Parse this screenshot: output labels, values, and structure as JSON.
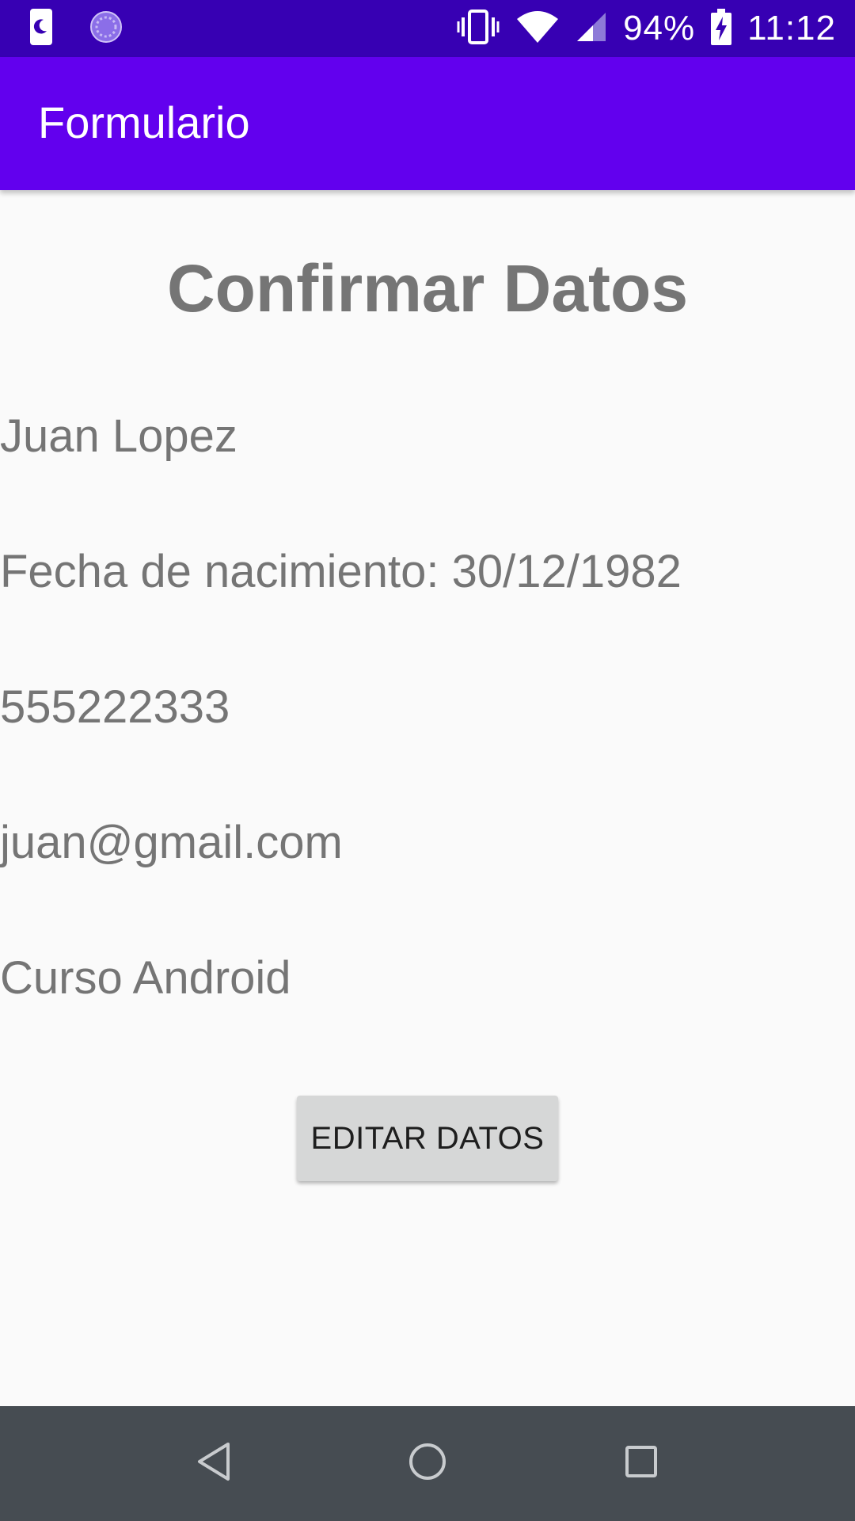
{
  "status_bar": {
    "battery": "94%",
    "time": "11:12",
    "icons": [
      "moon-icon",
      "sync-circle-icon",
      "vibrate-icon",
      "wifi-icon",
      "signal-icon",
      "battery-charging-icon"
    ]
  },
  "app_bar": {
    "title": "Formulario"
  },
  "main": {
    "heading": "Confirmar Datos",
    "name": "Juan Lopez",
    "birth_date": "Fecha de nacimiento: 30/12/1982",
    "phone": "555222333",
    "email": "juan@gmail.com",
    "description": "Curso Android",
    "edit_button_label": "EDITAR DATOS"
  },
  "nav_bar": {
    "icons": [
      "back-icon",
      "home-icon",
      "recents-icon"
    ]
  },
  "colors": {
    "status_bar": "#3700b3",
    "app_bar": "#6200ee",
    "background": "#fafafa",
    "text": "#757575",
    "button": "#d6d7d7",
    "nav_bar": "#464c52"
  }
}
